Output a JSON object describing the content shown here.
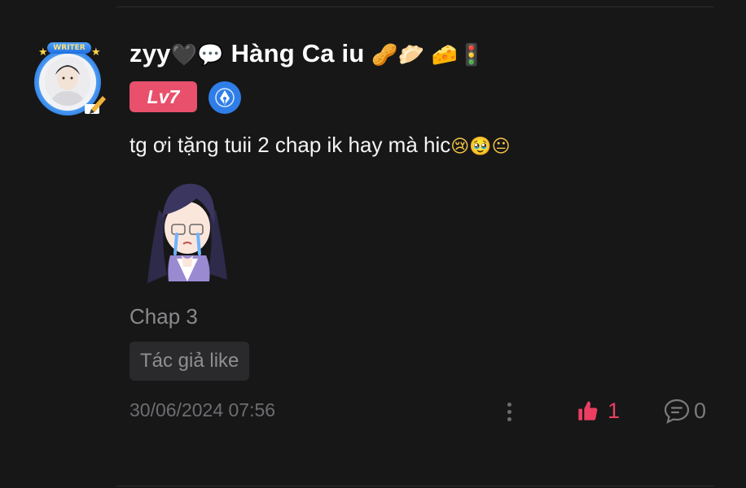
{
  "comment": {
    "author": {
      "name": "zyy",
      "name_emojis_before": "🖤💬",
      "nickname": "Hàng Ca iu",
      "name_emojis_after": "🥜🥟 🧀🚦",
      "avatar_badge": "WRITER",
      "level": "Lv7"
    },
    "text": "tg ơi tặng tuii 2 chap ik hay mà hic",
    "text_emojis": "😢🥹😐",
    "chapter": "Chap 3",
    "author_like_label": "Tác giả like",
    "timestamp": "30/06/2024 07:56",
    "likes": "1",
    "replies": "0"
  },
  "icons": {
    "more": "more-vertical-icon",
    "like": "thumbs-up-icon",
    "reply": "comment-bubble-icon",
    "pen": "pen-nib-icon"
  },
  "colors": {
    "background": "#171718",
    "level_badge": "#e8506b",
    "like_active": "#ec3e63",
    "muted_text": "#8a8a8d",
    "accent_blue": "#2f7ee8"
  }
}
